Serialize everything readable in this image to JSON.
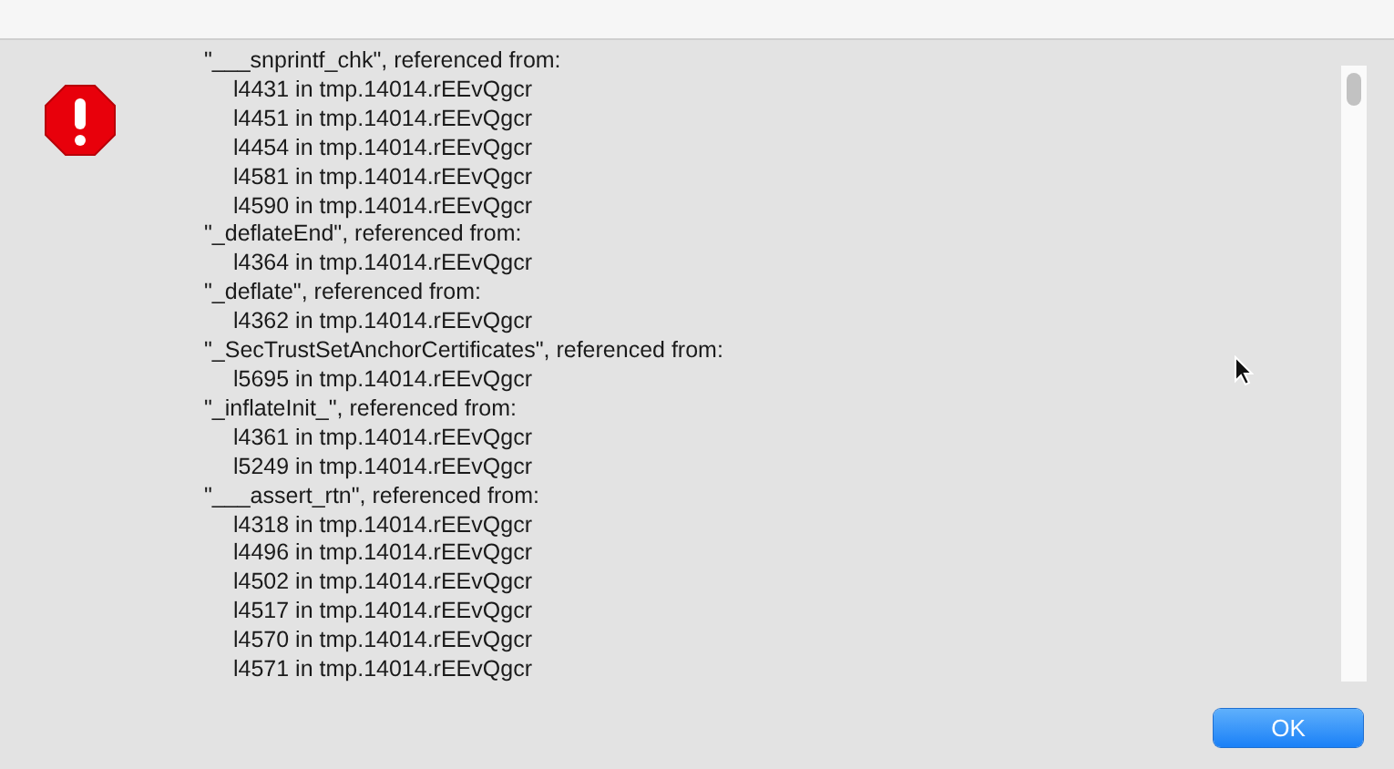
{
  "log_groups": [
    {
      "header": "\"___snprintf_chk\", referenced from:",
      "refs": [
        "l4431 in tmp.14014.rEEvQgcr",
        "l4451 in tmp.14014.rEEvQgcr",
        "l4454 in tmp.14014.rEEvQgcr",
        "l4581 in tmp.14014.rEEvQgcr",
        "l4590 in tmp.14014.rEEvQgcr"
      ]
    },
    {
      "header": "\"_deflateEnd\", referenced from:",
      "refs": [
        "l4364 in tmp.14014.rEEvQgcr"
      ]
    },
    {
      "header": "\"_deflate\", referenced from:",
      "refs": [
        "l4362 in tmp.14014.rEEvQgcr"
      ]
    },
    {
      "header": "\"_SecTrustSetAnchorCertificates\", referenced from:",
      "refs": [
        "l5695 in tmp.14014.rEEvQgcr"
      ]
    },
    {
      "header": "\"_inflateInit_\", referenced from:",
      "refs": [
        "l4361 in tmp.14014.rEEvQgcr",
        "l5249 in tmp.14014.rEEvQgcr"
      ]
    },
    {
      "header": "\"___assert_rtn\", referenced from:",
      "refs": [
        "l4318 in tmp.14014.rEEvQgcr",
        "l4496 in tmp.14014.rEEvQgcr",
        "l4502 in tmp.14014.rEEvQgcr",
        "l4517 in tmp.14014.rEEvQgcr",
        "l4570 in tmp.14014.rEEvQgcr",
        "l4571 in tmp.14014.rEEvQgcr"
      ]
    }
  ],
  "buttons": [
    {
      "label": "OK",
      "kind": "default"
    }
  ]
}
